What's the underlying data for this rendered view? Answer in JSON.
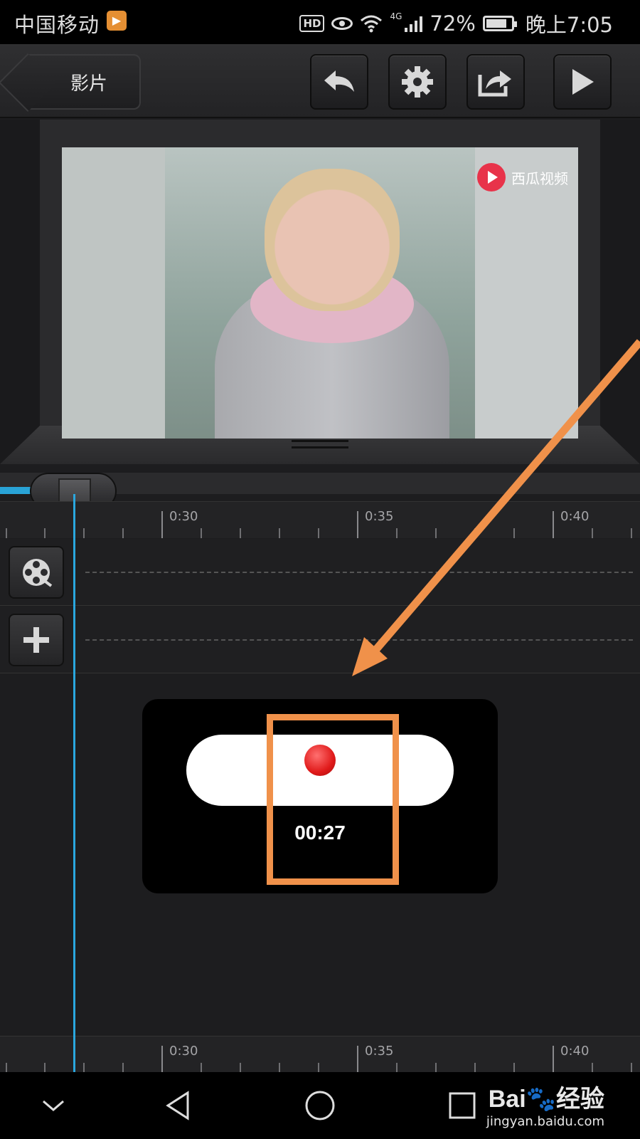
{
  "status_bar": {
    "carrier": "中国移动",
    "hd": "HD",
    "network": "4G",
    "battery": "72%",
    "time": "晚上7:05"
  },
  "toolbar": {
    "back_label": "影片",
    "icons": [
      "undo-icon",
      "gear-icon",
      "share-icon",
      "play-icon"
    ]
  },
  "preview": {
    "watermark": "西瓜视频"
  },
  "timeline": {
    "labels": [
      "0:30",
      "0:35",
      "0:40"
    ]
  },
  "tracks": [
    {
      "icon": "film-reel-icon"
    },
    {
      "icon": "plus-icon"
    }
  ],
  "recording": {
    "time": "00:27"
  },
  "nav_bar": {
    "icons": [
      "chevron-down-icon",
      "back-triangle-icon",
      "home-circle-icon",
      "recents-square-icon"
    ]
  },
  "watermark": {
    "brand": "Bai🐾经验",
    "site": "jingyan.baidu.com"
  },
  "colors": {
    "accent_blue": "#29a3d6",
    "record_red": "#e01a1a",
    "annotation_orange": "#f0914a"
  }
}
